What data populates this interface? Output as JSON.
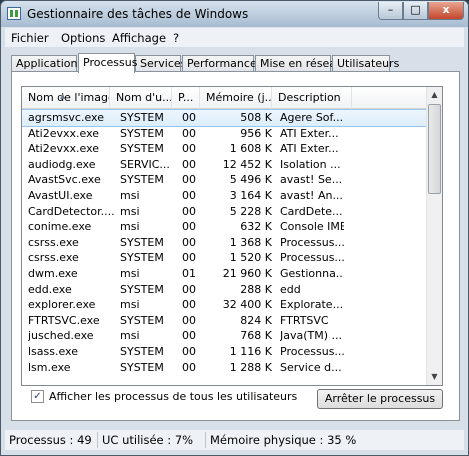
{
  "window": {
    "title": "Gestionnaire des tâches de Windows",
    "min_glyph": "–",
    "max_glyph": "□",
    "close_glyph": "x"
  },
  "menu": [
    "Fichier",
    "Options",
    "Affichage",
    "?"
  ],
  "tabs": [
    "Applications",
    "Processus",
    "Services",
    "Performances",
    "Mise en réseau",
    "Utilisateurs"
  ],
  "active_tab": "Processus",
  "columns": [
    "Nom de l'image",
    "Nom d'u...",
    "P...",
    "Mémoire (j...",
    "Description"
  ],
  "processes": [
    [
      "agrsmsvc.exe",
      "SYSTEM",
      "00",
      "508 K",
      "Agere Sof..."
    ],
    [
      "Ati2evxx.exe",
      "SYSTEM",
      "00",
      "956 K",
      "ATI Exter..."
    ],
    [
      "Ati2evxx.exe",
      "SYSTEM",
      "00",
      "1 608 K",
      "ATI Exter..."
    ],
    [
      "audiodg.exe",
      "SERVIC...",
      "00",
      "12 452 K",
      "Isolation ..."
    ],
    [
      "AvastSvc.exe",
      "SYSTEM",
      "00",
      "5 496 K",
      "avast! Se..."
    ],
    [
      "AvastUI.exe",
      "msi",
      "00",
      "3 164 K",
      "avast! An..."
    ],
    [
      "CardDetector....",
      "msi",
      "00",
      "5 228 K",
      "CardDete..."
    ],
    [
      "conime.exe",
      "msi",
      "00",
      "632 K",
      "Console IME"
    ],
    [
      "csrss.exe",
      "SYSTEM",
      "00",
      "1 368 K",
      "Processus..."
    ],
    [
      "csrss.exe",
      "SYSTEM",
      "00",
      "1 520 K",
      "Processus..."
    ],
    [
      "dwm.exe",
      "msi",
      "01",
      "21 960 K",
      "Gestionna..."
    ],
    [
      "edd.exe",
      "SYSTEM",
      "00",
      "288 K",
      "edd"
    ],
    [
      "explorer.exe",
      "msi",
      "00",
      "32 400 K",
      "Explorate..."
    ],
    [
      "FTRTSVC.exe",
      "SYSTEM",
      "00",
      "824 K",
      "FTRTSVC"
    ],
    [
      "jusched.exe",
      "msi",
      "00",
      "768 K",
      "Java(TM) ..."
    ],
    [
      "lsass.exe",
      "SYSTEM",
      "00",
      "1 116 K",
      "Processus..."
    ],
    [
      "lsm.exe",
      "SYSTEM",
      "00",
      "1 288 K",
      "Service d..."
    ]
  ],
  "selected_row": 0,
  "show_all_users": {
    "label": "Afficher les processus de tous les utilisateurs",
    "checked": true
  },
  "end_process_button": "Arrêter le processus",
  "status": {
    "processes": "Processus : 49",
    "cpu": "UC utilisée : 7%",
    "memory": "Mémoire physique : 35 %"
  }
}
